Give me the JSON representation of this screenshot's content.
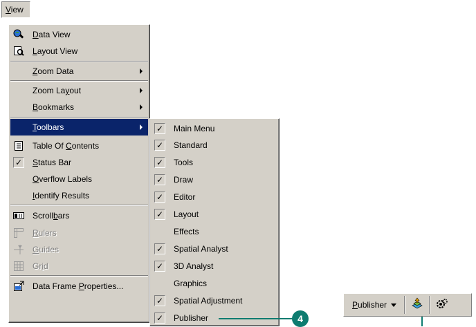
{
  "menubar": {
    "view_label": "View",
    "view_label_underline": "V",
    "view_label_rest": "iew"
  },
  "view_menu": {
    "items": [
      {
        "id": "data-view",
        "pre": "",
        "ul": "D",
        "post": "ata View",
        "icon": "data-view-icon"
      },
      {
        "id": "layout-view",
        "pre": "",
        "ul": "L",
        "post": "ayout View",
        "icon": "layout-view-icon"
      },
      {
        "id": "zoom-data",
        "pre": "",
        "ul": "Z",
        "post": "oom Data",
        "submenu": true
      },
      {
        "id": "zoom-layout",
        "pre": "Zoom La",
        "ul": "y",
        "post": "out",
        "submenu": true
      },
      {
        "id": "bookmarks",
        "pre": "",
        "ul": "B",
        "post": "ookmarks",
        "submenu": true
      },
      {
        "id": "toolbars",
        "pre": "",
        "ul": "T",
        "post": "oolbars",
        "submenu": true,
        "active": true
      },
      {
        "id": "table-of-contents",
        "pre": "Table Of ",
        "ul": "C",
        "post": "ontents",
        "icon": "table-of-contents-icon"
      },
      {
        "id": "status-bar",
        "pre": "",
        "ul": "S",
        "post": "tatus Bar",
        "checked": true
      },
      {
        "id": "overflow-labels",
        "pre": "",
        "ul": "O",
        "post": "verflow Labels"
      },
      {
        "id": "identify-results",
        "pre": "",
        "ul": "I",
        "post": "dentify Results"
      },
      {
        "id": "scrollbars",
        "pre": "Scroll",
        "ul": "b",
        "post": "ars",
        "icon": "scrollbars-icon"
      },
      {
        "id": "rulers",
        "pre": "",
        "ul": "R",
        "post": "ulers",
        "icon": "rulers-icon",
        "disabled": true
      },
      {
        "id": "guides",
        "pre": "",
        "ul": "G",
        "post": "uides",
        "icon": "guides-icon",
        "disabled": true
      },
      {
        "id": "grid",
        "pre": "Gr",
        "ul": "i",
        "post": "d",
        "icon": "grid-icon",
        "disabled": true
      },
      {
        "id": "data-frame-properties",
        "pre": "Data Frame ",
        "ul": "P",
        "post": "roperties...",
        "icon": "data-frame-properties-icon"
      }
    ]
  },
  "toolbars_submenu": {
    "items": [
      {
        "label": "Main Menu",
        "checked": true
      },
      {
        "label": "Standard",
        "checked": true
      },
      {
        "label": "Tools",
        "checked": true
      },
      {
        "label": "Draw",
        "checked": true
      },
      {
        "label": "Editor",
        "checked": true
      },
      {
        "label": "Layout",
        "checked": true
      },
      {
        "label": "Effects",
        "checked": false
      },
      {
        "label": "Spatial Analyst",
        "checked": true
      },
      {
        "label": "3D Analyst",
        "checked": true
      },
      {
        "label": "Graphics",
        "checked": false
      },
      {
        "label": "Spatial Adjustment",
        "checked": true
      },
      {
        "label": "Publisher",
        "checked": true
      }
    ],
    "check_glyph": "✓"
  },
  "callout": {
    "number": "4",
    "color": "#0e7c70"
  },
  "publisher_toolbar": {
    "dropdown_ul": "P",
    "dropdown_rest": "ublisher",
    "buttons": [
      "publisher-map-icon",
      "publisher-settings-icon"
    ]
  },
  "colors": {
    "menu_bg": "#d4d0c8",
    "highlight": "#0a246a",
    "disabled_text": "#808080"
  }
}
